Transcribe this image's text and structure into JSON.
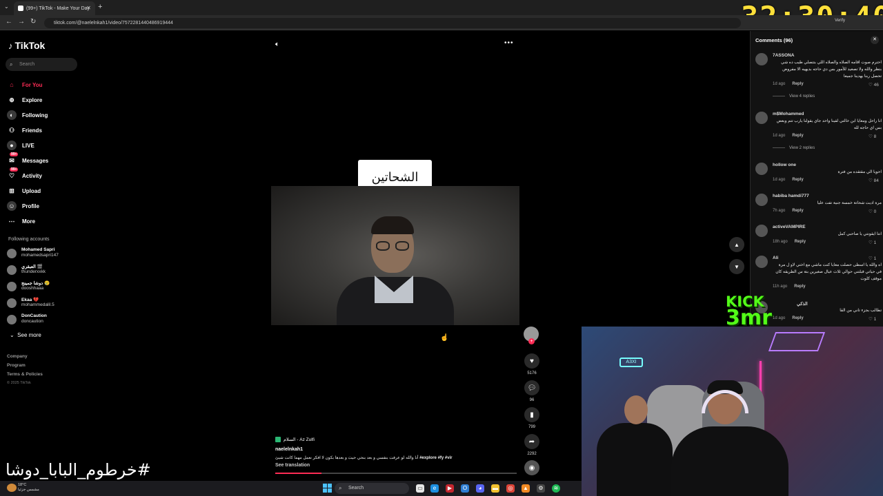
{
  "browser": {
    "tab_title": "(99+) TikTok - Make Your Day",
    "url": "tiktok.com/@naelelnkah1/video/7572281440486919444",
    "verify_label": "Verify",
    "timer": "32:30:40"
  },
  "sidebar": {
    "brand": "TikTok",
    "search_placeholder": "Search",
    "items": [
      {
        "label": "For You",
        "icon": "home-icon"
      },
      {
        "label": "Explore",
        "icon": "compass-icon"
      },
      {
        "label": "Following",
        "icon": "following-icon"
      },
      {
        "label": "Friends",
        "icon": "friends-icon"
      },
      {
        "label": "LIVE",
        "icon": "live-icon"
      },
      {
        "label": "Messages",
        "icon": "messages-icon",
        "badge": "99+"
      },
      {
        "label": "Activity",
        "icon": "activity-icon",
        "badge": "99+"
      },
      {
        "label": "Upload",
        "icon": "upload-icon"
      },
      {
        "label": "Profile",
        "icon": "profile-icon"
      },
      {
        "label": "More",
        "icon": "more-icon"
      }
    ],
    "following_title": "Following accounts",
    "following": [
      {
        "name": "Mohamed Sapri",
        "handle": "mohamedsapri147"
      },
      {
        "name": "العبقري 🎬",
        "handle": "thunderxxkk"
      },
      {
        "name": "دوشا جمينج 😢",
        "handle": "dooshhaaa"
      },
      {
        "name": "Ekaa 💔",
        "handle": "mohammedalil.5"
      },
      {
        "name": "DonCaution",
        "handle": "doncaution"
      }
    ],
    "see_more": "See more",
    "footer": [
      "Company",
      "Program",
      "Terms & Policies"
    ],
    "copyright": "© 2025 TikTok"
  },
  "video": {
    "caption_box": "الشحاتين",
    "sound": "السلام - Az Zulfi",
    "author": "naelelnkah1",
    "description": "أنا والله لو عرفت بنفسي و بعد بنحي حيث و بعدها بكون لا افكر نعمل مهما كانت شيئ",
    "hashtags": "#explore #fy #vir",
    "see_translation": "See translation",
    "progress": 0.19,
    "likes": "5176",
    "comments": "96",
    "saves": "799",
    "shares": "2292"
  },
  "comments_panel": {
    "title": "Comments (96)",
    "comments": [
      {
        "user": "7ASSONA",
        "text": "احترم صوت اقامه الصلاه والصلاه اللي بتتصلي طيب ده شي بتظر والله ولا تصعيد للأمور بس دي حاجه بديهيه الا مفروض تحصل ربنا يهدينا جميعا",
        "time": "1d ago",
        "reply": "Reply",
        "likes": "46",
        "replies": "View 4 replies"
      },
      {
        "user": "m$Mohammed",
        "text": "انا راحل ومعايا ابن خالتي لقينا واحد جاي يقولنا يارب تتم وبعض بس اي حاجه لله",
        "time": "1d ago",
        "reply": "Reply",
        "likes": "8",
        "replies": "View 2 replies"
      },
      {
        "user": "hollow one",
        "text": "احويا الي مقتقده من فترة",
        "time": "1d ago",
        "reply": "Reply",
        "likes": "84"
      },
      {
        "user": "habiba hamdi777",
        "text": "مرة اديت شحاتة خمسة جنية تفت عليا",
        "time": "7h ago",
        "reply": "Reply",
        "likes": "0"
      },
      {
        "user": "activeVAMPIRE",
        "text": "انتا ايقونتي يا صاحبي كمل",
        "time": "18h ago",
        "reply": "Reply",
        "likes": "1"
      },
      {
        "user": "Ali",
        "text": "اه والله يا اسطى حصلت معايا كنت ماشي مع اختي لاو ل مرة في حياتي قبلتني حوالي ثلاث عيال صغيرين بتة س الطريقه كان موقف كلوت",
        "time": "11h ago",
        "reply": "Reply",
        "likes": "1"
      },
      {
        "user": "الذكي",
        "text": "تطالب بجزء تاني من القا",
        "time": "1d ago",
        "reply": "Reply",
        "likes": "1"
      }
    ]
  },
  "stream": {
    "kick_line1": "KICK",
    "kick_line2": "3mr",
    "overlay_hashtag": "#خرطوم_البابا_دوشا"
  },
  "taskbar": {
    "search_placeholder": "Search",
    "weather_temp": "18°C",
    "weather_desc": "مشمس جزئيا"
  }
}
